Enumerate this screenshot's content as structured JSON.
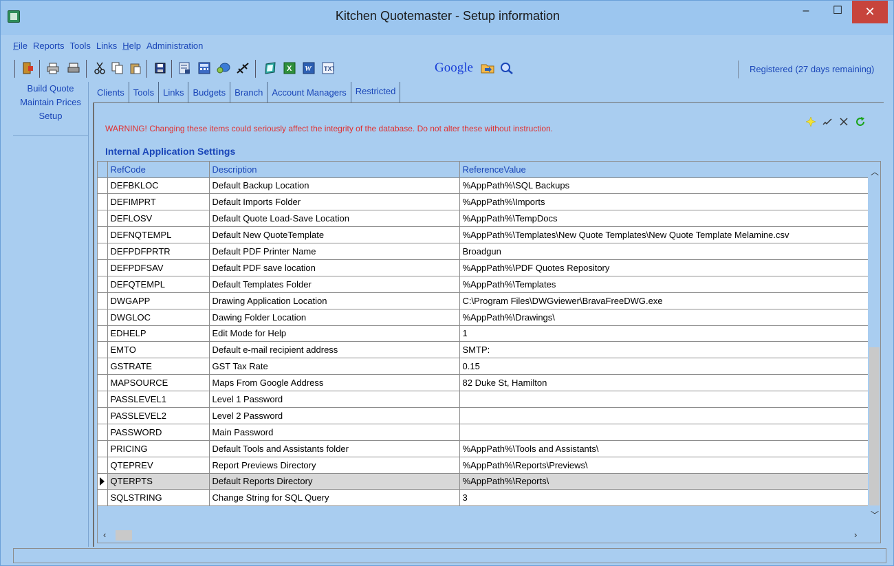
{
  "window": {
    "title": "Kitchen Quotemaster - Setup information",
    "min_glyph": "–",
    "max_glyph": "☐",
    "close_glyph": "✕"
  },
  "menu": [
    "File",
    "Reports",
    "Tools",
    "Links",
    "Help",
    "Administration"
  ],
  "toolbar": {
    "google_label": "Google",
    "registration_status": "Registered (27 days remaining)"
  },
  "sidebar": {
    "items": [
      "Build Quote",
      "Maintain Prices",
      "Setup"
    ]
  },
  "tabs": [
    "Clients",
    "Tools",
    "Links",
    "Budgets",
    "Branch",
    "Account Managers",
    "Restricted"
  ],
  "active_tab": "Restricted",
  "restricted": {
    "warning": "WARNING! Changing these items could seriously affect the integrity of the  database. Do not alter  these without instruction.",
    "section_title": "Internal Application Settings",
    "columns": [
      "RefCode",
      "Description",
      "ReferenceValue"
    ],
    "rows": [
      [
        "DEFBKLOC",
        "Default Backup Location",
        "%AppPath%\\SQL Backups"
      ],
      [
        "DEFIMPRT",
        "Default Imports Folder",
        "%AppPath%\\Imports"
      ],
      [
        "DEFLOSV",
        "Default Quote Load-Save Location",
        "%AppPath%\\TempDocs"
      ],
      [
        "DEFNQTEMPL",
        "Default New QuoteTemplate",
        "%AppPath%\\Templates\\New Quote Templates\\New Quote Template Melamine.csv"
      ],
      [
        "DEFPDFPRTR",
        "Default PDF Printer Name",
        "Broadgun"
      ],
      [
        "DEFPDFSAV",
        "Default PDF save location",
        "%AppPath%\\PDF Quotes Repository"
      ],
      [
        "DEFQTEMPL",
        "Default Templates Folder",
        "%AppPath%\\Templates"
      ],
      [
        "DWGAPP",
        "Drawing Application Location",
        "C:\\Program Files\\DWGviewer\\BravaFreeDWG.exe"
      ],
      [
        "DWGLOC",
        "Dawing Folder Location",
        "%AppPath%\\Drawings\\"
      ],
      [
        "EDHELP",
        "Edit Mode for Help",
        "1"
      ],
      [
        "EMTO",
        "Default e-mail recipient address",
        "SMTP:"
      ],
      [
        "GSTRATE",
        "GST Tax Rate",
        "0.15"
      ],
      [
        "MAPSOURCE",
        "Maps From Google Address",
        "82 Duke St, Hamilton"
      ],
      [
        "PASSLEVEL1",
        "Level 1 Password",
        ""
      ],
      [
        "PASSLEVEL2",
        "Level 2 Password",
        ""
      ],
      [
        "PASSWORD",
        "Main Password",
        ""
      ],
      [
        "PRICING",
        "Default Tools and Assistants folder",
        "%AppPath%\\Tools and Assistants\\"
      ],
      [
        "QTEPREV",
        "Report Previews Directory",
        "%AppPath%\\Reports\\Previews\\"
      ],
      [
        "QTERPTS",
        "Default Reports Directory",
        "%AppPath%\\Reports\\"
      ],
      [
        "SQLSTRING",
        "Change String for SQL Query",
        "3"
      ]
    ],
    "current_row": 18
  },
  "colors": {
    "background": "#a9cdf0",
    "link_text": "#1a46b8",
    "warning_text": "#e03030",
    "close_button": "#c7443c"
  }
}
